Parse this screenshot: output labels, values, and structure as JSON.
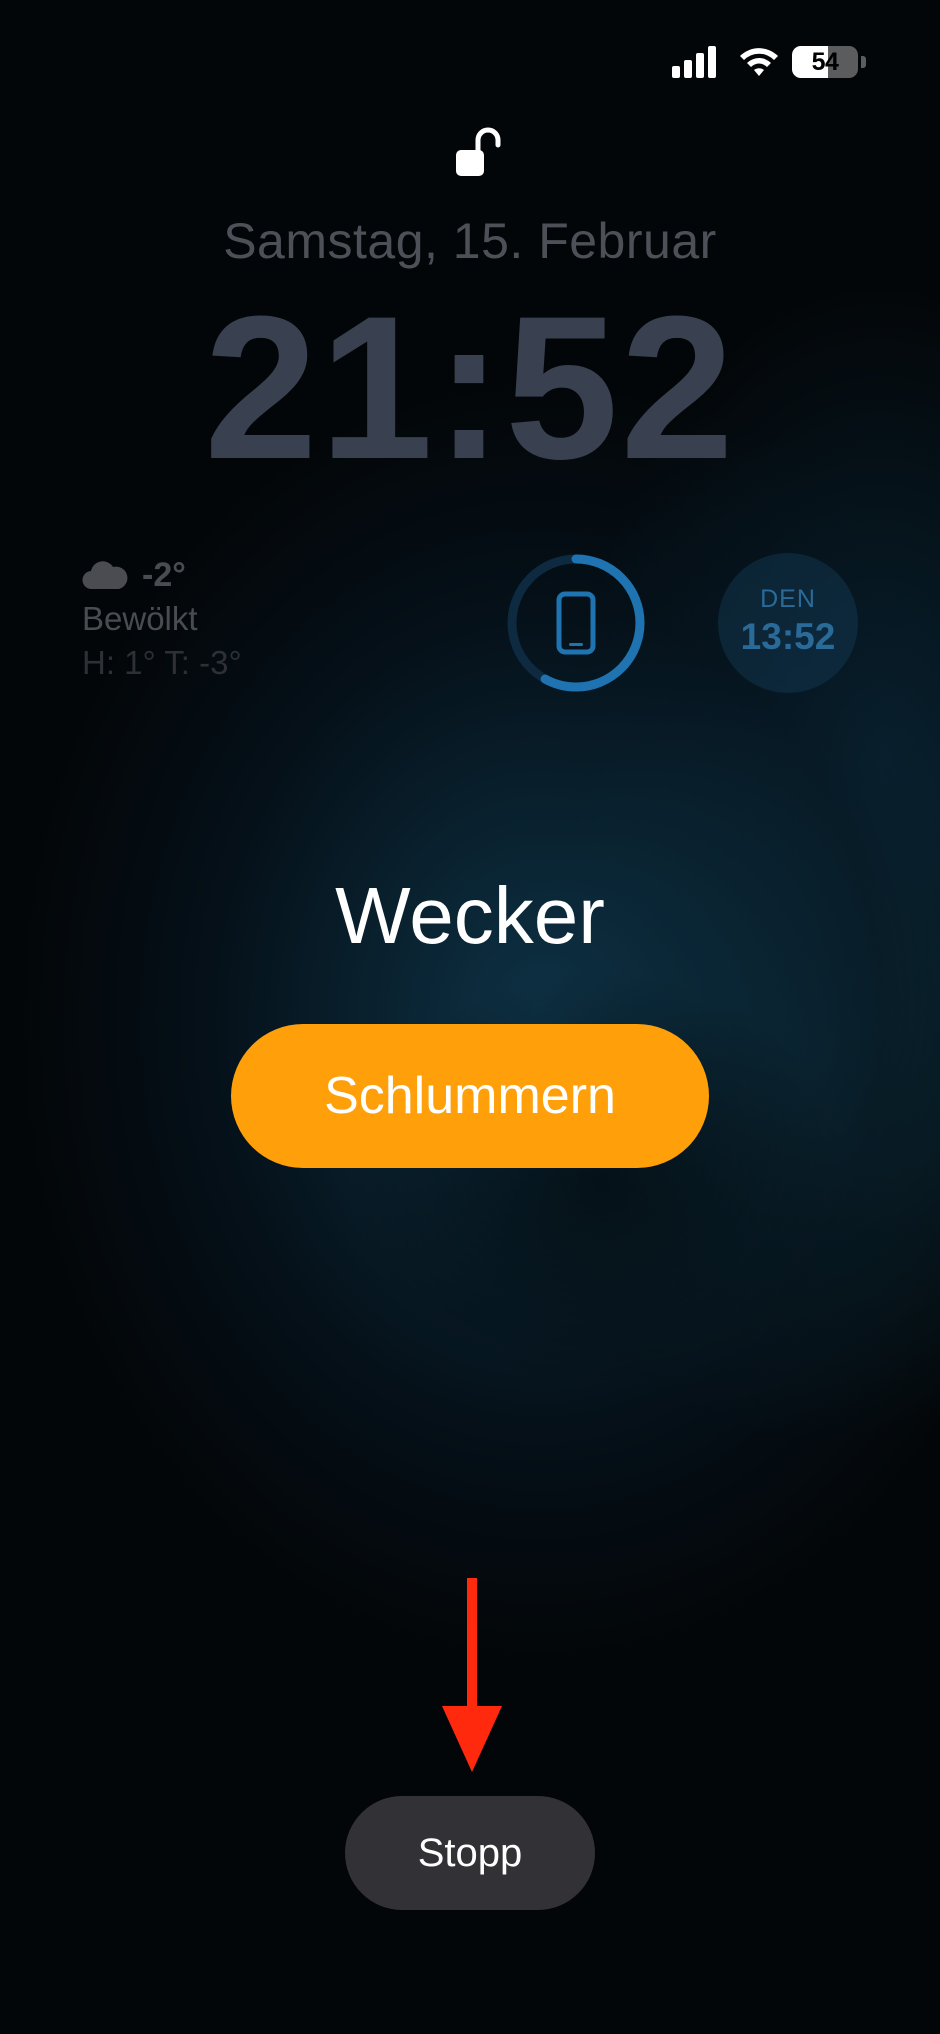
{
  "status_bar": {
    "signal_icon": "cellular-signal-icon",
    "wifi_icon": "wifi-icon",
    "battery_icon": "battery-icon",
    "battery_level": 54,
    "battery_label": "54"
  },
  "lock_screen": {
    "lock_icon": "unlocked-padlock-icon",
    "date": "Samstag, 15. Februar",
    "time": "21:52"
  },
  "widgets": {
    "weather": {
      "icon": "cloud-icon",
      "temperature": "-2°",
      "condition": "Bewölkt",
      "high_low": "H: 1° T: -3°"
    },
    "screen_time": {
      "icon": "iphone-icon",
      "ring_progress": 0.58,
      "ring_color": "#1e73b0"
    },
    "world_clock": {
      "city": "DEN",
      "time": "13:52"
    }
  },
  "alarm": {
    "title": "Wecker",
    "snooze_label": "Schlummern",
    "stop_label": "Stopp"
  },
  "annotation": {
    "arrow_icon": "red-down-arrow-icon",
    "color": "#ff2a0e"
  },
  "colors": {
    "snooze": "#ff9f0a",
    "stop": "#323236"
  }
}
